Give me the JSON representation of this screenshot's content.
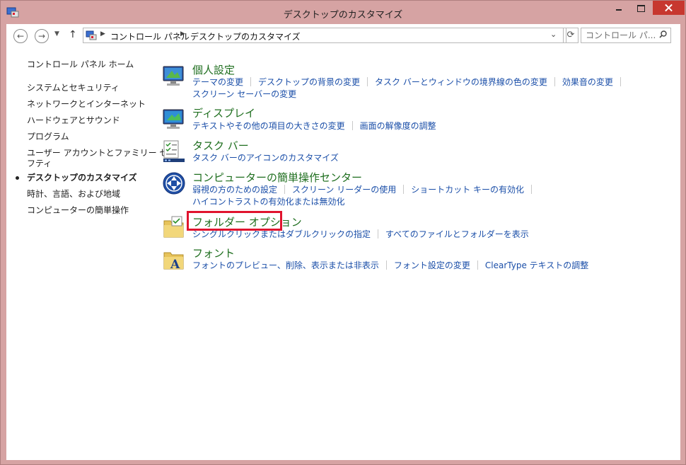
{
  "window": {
    "title": "デスクトップのカスタマイズ"
  },
  "addressbar": {
    "crumbs": [
      "コントロール パネル",
      "デスクトップのカスタマイズ"
    ]
  },
  "search": {
    "placeholder": "コントロール パ..."
  },
  "sidebar": {
    "items": [
      {
        "label": "コントロール パネル ホーム"
      },
      {
        "label": "システムとセキュリティ"
      },
      {
        "label": "ネットワークとインターネット"
      },
      {
        "label": "ハードウェアとサウンド"
      },
      {
        "label": "プログラム"
      },
      {
        "label": "ユーザー アカウントとファミリー セー"
      },
      {
        "label": "フティ"
      },
      {
        "label": "デスクトップのカスタマイズ"
      },
      {
        "label": "時計、言語、および地域"
      },
      {
        "label": "コンピューターの簡単操作"
      }
    ]
  },
  "categories": [
    {
      "title": "個人設定",
      "icon": "personalization-icon",
      "links": [
        "テーマの変更",
        "デスクトップの背景の変更",
        "タスク バーとウィンドウの境界線の色の変更",
        "効果音の変更",
        "スクリーン セーバーの変更"
      ]
    },
    {
      "title": "ディスプレイ",
      "icon": "display-icon",
      "links": [
        "テキストやその他の項目の大きさの変更",
        "画面の解像度の調整"
      ]
    },
    {
      "title": "タスク バー",
      "icon": "taskbar-icon",
      "links": [
        "タスク バーのアイコンのカスタマイズ"
      ]
    },
    {
      "title": "コンピューターの簡単操作センター",
      "icon": "ease-of-access-icon",
      "links": [
        "弱視の方のための設定",
        "スクリーン リーダーの使用",
        "ショートカット キーの有効化",
        "ハイコントラストの有効化または無効化"
      ]
    },
    {
      "title": "フォルダー オプション",
      "icon": "folder-options-icon",
      "links": [
        "シングルクリックまたはダブルクリックの指定",
        "すべてのファイルとフォルダーを表示"
      ]
    },
    {
      "title": "フォント",
      "icon": "fonts-icon",
      "links": [
        "フォントのプレビュー、削除、表示または非表示",
        "フォント設定の変更",
        "ClearType テキストの調整"
      ]
    }
  ],
  "colors": {
    "frame": "#d6a3a3",
    "close": "#c7372f",
    "category_title": "#1e6e1e",
    "link": "#1a4ea8",
    "highlight": "#e0142e"
  }
}
